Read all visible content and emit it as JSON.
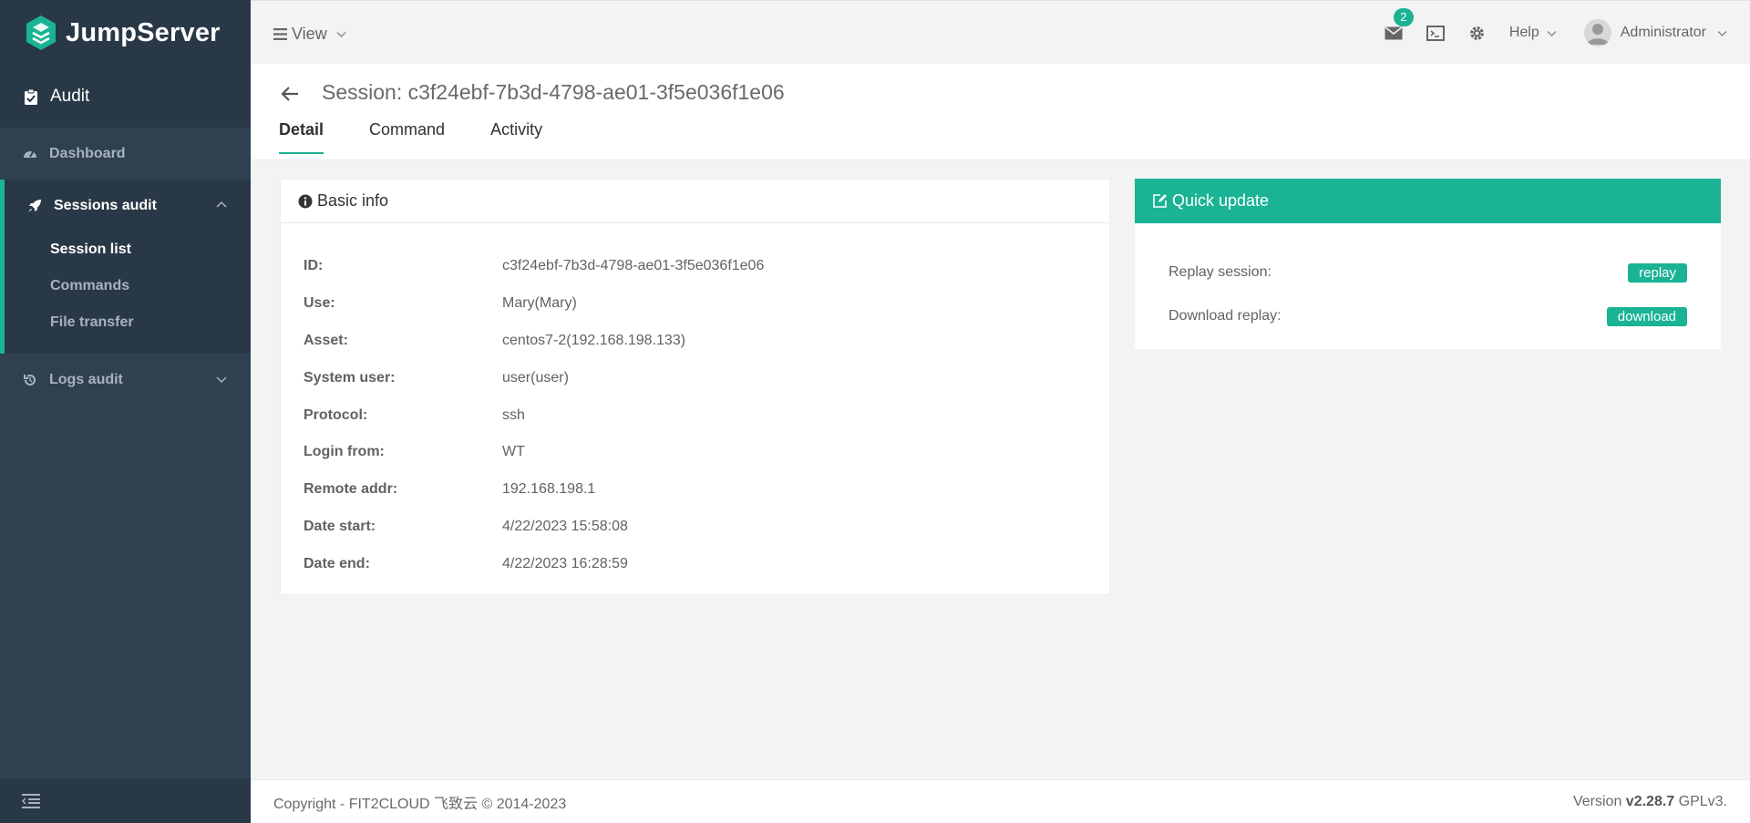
{
  "sidebar": {
    "logo_text": "JumpServer",
    "section_title": "Audit",
    "items": [
      {
        "label": "Dashboard"
      },
      {
        "label": "Sessions audit",
        "children": [
          {
            "label": "Session list"
          },
          {
            "label": "Commands"
          },
          {
            "label": "File transfer"
          }
        ]
      },
      {
        "label": "Logs audit"
      }
    ]
  },
  "topbar": {
    "view_label": "View",
    "message_count": "2",
    "help_label": "Help",
    "user_name": "Administrator"
  },
  "page": {
    "title": "Session: c3f24ebf-7b3d-4798-ae01-3f5e036f1e06",
    "tabs": [
      {
        "label": "Detail"
      },
      {
        "label": "Command"
      },
      {
        "label": "Activity"
      }
    ]
  },
  "basic_info": {
    "title": "Basic info",
    "rows": [
      {
        "label": "ID:",
        "value": "c3f24ebf-7b3d-4798-ae01-3f5e036f1e06"
      },
      {
        "label": "Use:",
        "value": "Mary(Mary)"
      },
      {
        "label": "Asset:",
        "value": "centos7-2(192.168.198.133)"
      },
      {
        "label": "System user:",
        "value": "user(user)"
      },
      {
        "label": "Protocol:",
        "value": "ssh"
      },
      {
        "label": "Login from:",
        "value": "WT"
      },
      {
        "label": "Remote addr:",
        "value": "192.168.198.1"
      },
      {
        "label": "Date start:",
        "value": "4/22/2023 15:58:08"
      },
      {
        "label": "Date end:",
        "value": "4/22/2023 16:28:59"
      }
    ]
  },
  "quick_update": {
    "title": "Quick update",
    "rows": [
      {
        "label": "Replay session:",
        "button": "replay"
      },
      {
        "label": "Download replay:",
        "button": "download"
      }
    ]
  },
  "footer": {
    "copyright": "Copyright - FIT2CLOUD 飞致云 © 2014-2023",
    "version_prefix": "Version",
    "version": "v2.28.7",
    "license": "GPLv3."
  },
  "colors": {
    "accent": "#1ab394",
    "sidebar_bg": "#2f4050",
    "sidebar_dark": "#293846"
  }
}
